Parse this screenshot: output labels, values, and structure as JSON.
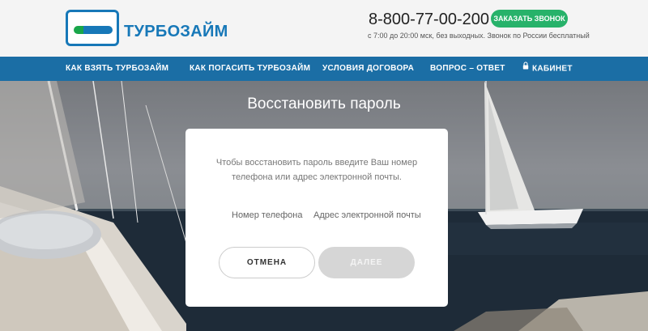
{
  "header": {
    "logo_text": "ТУРБОЗАЙМ",
    "phone": "8-800-77-00-200",
    "call_button": "ЗАКАЗАТЬ ЗВОНОК",
    "hours": "с 7:00 до 20:00 мск, без выходных. Звонок по России бесплатный"
  },
  "nav": {
    "items": [
      {
        "label": "КАК ВЗЯТЬ ТУРБОЗАЙМ"
      },
      {
        "label": "КАК ПОГАСИТЬ ТУРБОЗАЙМ"
      },
      {
        "label": "УСЛОВИЯ ДОГОВОРА"
      },
      {
        "label": "ВОПРОС – ОТВЕТ"
      },
      {
        "label": "КАБИНЕТ",
        "icon": "lock-icon"
      }
    ]
  },
  "page": {
    "title": "Восстановить пароль"
  },
  "modal": {
    "description": "Чтобы восстановить пароль введите Ваш номер телефона или адрес электронной почты.",
    "option_phone": "Номер телефона",
    "option_email": "Адрес электронной почты",
    "cancel_button": "ОТМЕНА",
    "next_button": "ДАЛЕЕ"
  },
  "colors": {
    "brand_blue": "#1778b8",
    "nav_blue": "#1b6ea5",
    "accent_green": "#27b26a"
  }
}
